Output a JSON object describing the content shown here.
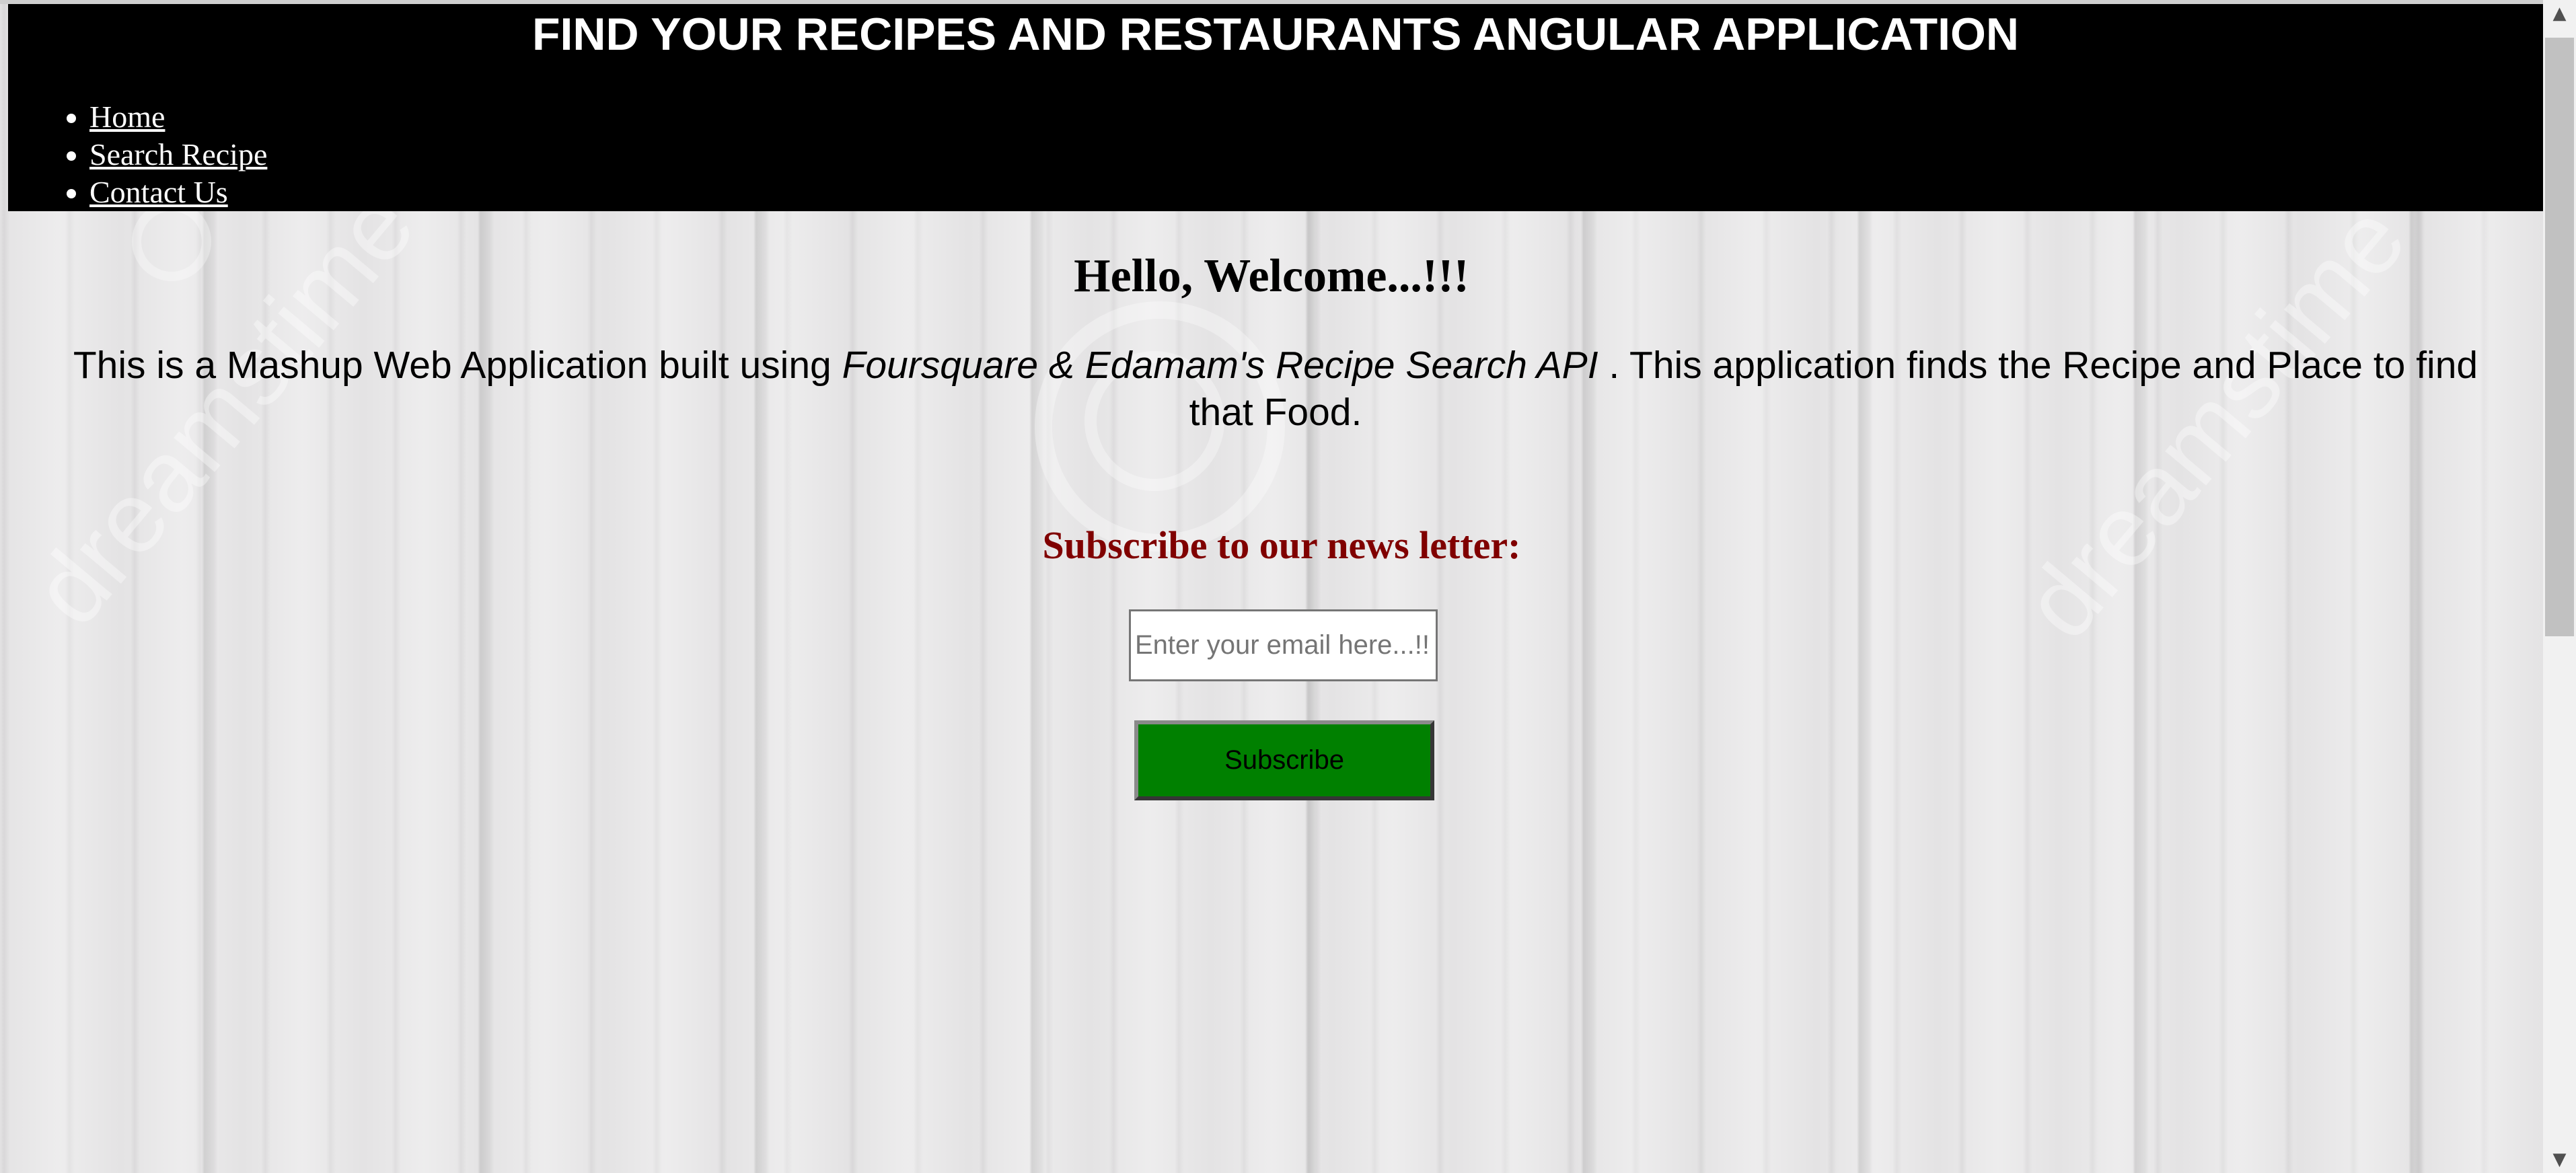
{
  "header": {
    "title": "FIND YOUR RECIPES AND RESTAURANTS ANGULAR APPLICATION",
    "nav": [
      "Home",
      "Search Recipe",
      "Contact Us"
    ]
  },
  "main": {
    "welcome": "Hello, Welcome...!!!",
    "intro_prefix": "This is a Mashup Web Application built using ",
    "intro_apis": "Foursquare & Edamam's Recipe Search API",
    "intro_suffix": " . This application finds the Recipe and Place to find",
    "intro_line2": "that Food.",
    "subscribe_heading": "Subscribe to our news letter:",
    "email_placeholder": "Enter your email here...!!",
    "subscribe_label": "Subscribe"
  },
  "colors": {
    "header_bg": "#000000",
    "subscribe_heading": "#800000",
    "subscribe_button": "#008000"
  },
  "icons": [
    "scroll-up-arrow-icon",
    "scroll-down-arrow-icon"
  ]
}
